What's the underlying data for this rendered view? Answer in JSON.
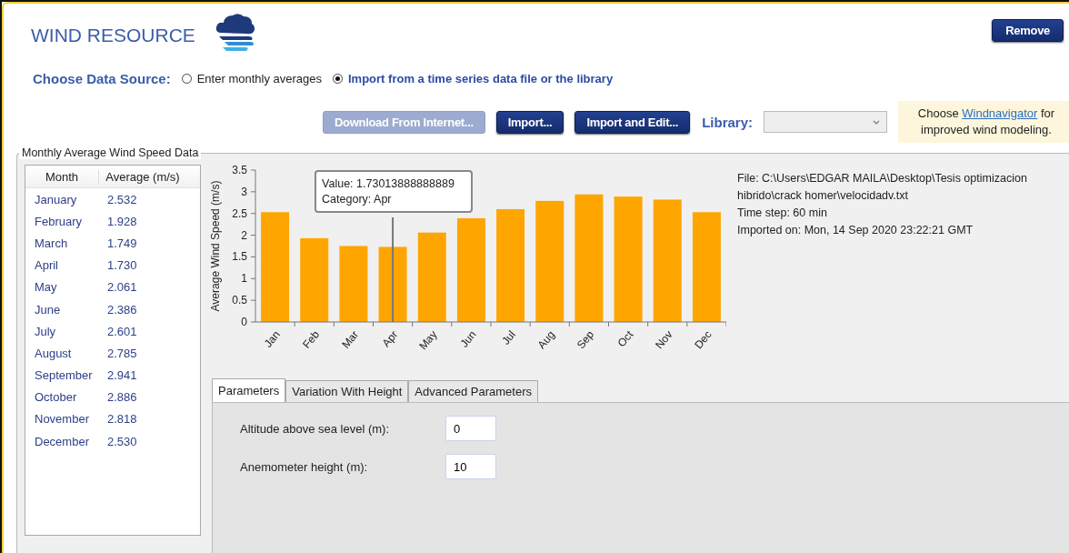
{
  "title": "WIND RESOURCE",
  "remove_button": "Remove",
  "data_source": {
    "label": "Choose Data Source:",
    "options": [
      {
        "label": "Enter monthly averages",
        "selected": false
      },
      {
        "label": "Import from a time series data file or the library",
        "selected": true
      }
    ]
  },
  "buttons": [
    {
      "label": "Download From Internet...",
      "disabled": true
    },
    {
      "label": "Import...",
      "disabled": false
    },
    {
      "label": "Import and Edit...",
      "disabled": false
    }
  ],
  "library": {
    "label": "Library:"
  },
  "note": {
    "before": "Choose ",
    "link": "Windnavigator",
    "after": " for improved wind modeling."
  },
  "group": {
    "title": "Monthly Average Wind Speed Data"
  },
  "table": {
    "columns": [
      "Month",
      "Average (m/s)"
    ],
    "rows": [
      [
        "January",
        "2.532"
      ],
      [
        "February",
        "1.928"
      ],
      [
        "March",
        "1.749"
      ],
      [
        "April",
        "1.730"
      ],
      [
        "May",
        "2.061"
      ],
      [
        "June",
        "2.386"
      ],
      [
        "July",
        "2.601"
      ],
      [
        "August",
        "2.785"
      ],
      [
        "September",
        "2.941"
      ],
      [
        "October",
        "2.886"
      ],
      [
        "November",
        "2.818"
      ],
      [
        "December",
        "2.530"
      ]
    ]
  },
  "chart": {
    "chart_data": {
      "type": "bar",
      "ylabel": "Average Wind Speed (m/s)",
      "categories": [
        "Jan",
        "Feb",
        "Mar",
        "Apr",
        "May",
        "Jun",
        "Jul",
        "Aug",
        "Sep",
        "Oct",
        "Nov",
        "Dec"
      ],
      "series": [
        {
          "color": "#ffa500",
          "values": [
            2.53,
            1.93,
            1.75,
            1.73,
            2.06,
            2.39,
            2.6,
            2.79,
            2.94,
            2.89,
            2.82,
            2.53
          ]
        }
      ],
      "ylim": [
        0,
        3.5
      ],
      "yticks": [
        0,
        0.5,
        1,
        1.5,
        2,
        2.5,
        3,
        3.5
      ]
    },
    "tooltip": {
      "value_label": "Value:",
      "value": "1.73013888888889",
      "category_label": "Category:",
      "category": "Apr"
    }
  },
  "file_info": [
    "File: C:\\Users\\EDGAR MAILA\\Desktop\\Tesis optimizacion hibrido\\crack homer\\velocidadv.txt",
    "Time step: 60 min",
    "Imported on: Mon, 14 Sep 2020 23:22:21 GMT"
  ],
  "tabs": [
    {
      "label": "Parameters",
      "selected": true
    },
    {
      "label": "Variation With Height",
      "selected": false
    },
    {
      "label": "Advanced Parameters",
      "selected": false
    }
  ],
  "fields": [
    {
      "label": "Altitude above sea level (m):",
      "value": "0"
    },
    {
      "label": "Anemometer height (m):",
      "value": "10"
    }
  ]
}
